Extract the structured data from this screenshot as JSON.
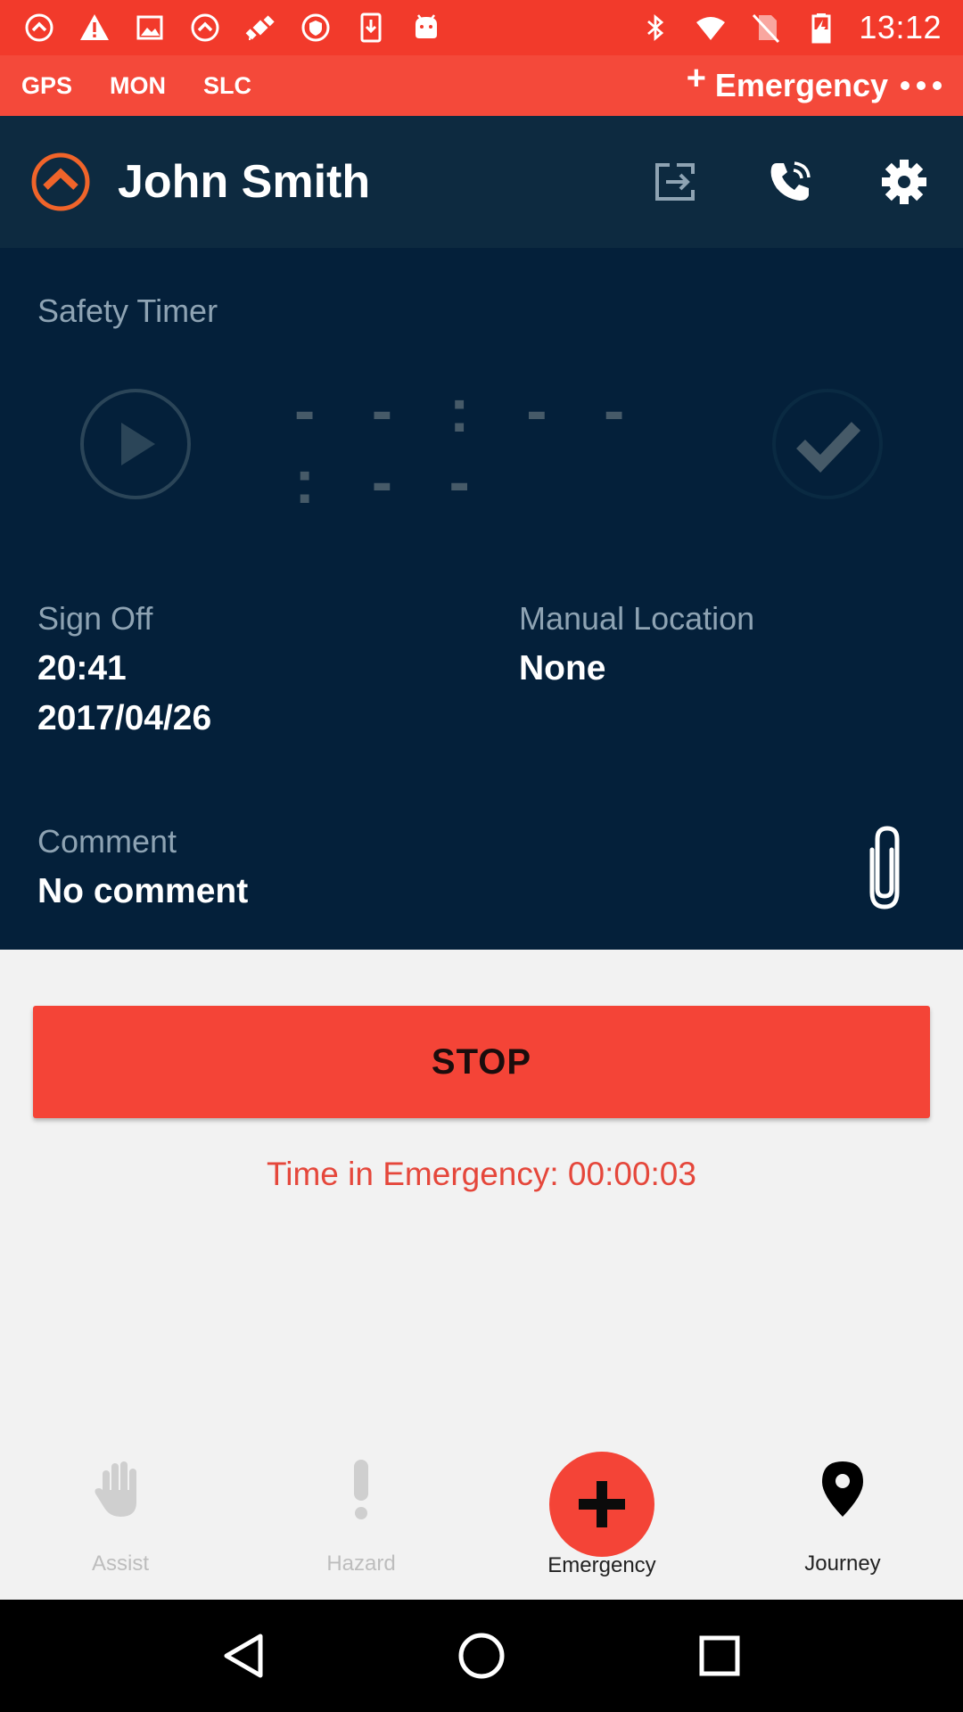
{
  "status_bar": {
    "time": "13:12",
    "left_icons": [
      "app-chevron-icon",
      "warning-icon",
      "image-icon",
      "app-chevron-icon",
      "fake-gps-icon",
      "shield-icon",
      "download-icon",
      "android-icon"
    ],
    "right_icons": [
      "bluetooth-icon",
      "wifi-icon",
      "no-sim-icon",
      "battery-charging-icon"
    ]
  },
  "mode_bar": {
    "tags": [
      "GPS",
      "MON",
      "SLC"
    ],
    "emergency_label": "Emergency",
    "plus": "+"
  },
  "header": {
    "user_name": "John Smith"
  },
  "safety_timer": {
    "label": "Safety Timer",
    "display": "- - : - - : - -"
  },
  "sign_off": {
    "label": "Sign Off",
    "time": "20:41",
    "date": "2017/04/26"
  },
  "manual_location": {
    "label": "Manual Location",
    "value": "None"
  },
  "comment": {
    "label": "Comment",
    "value": "No comment"
  },
  "actions": {
    "stop_label": "STOP",
    "emergency_time": "Time in Emergency: 00:00:03"
  },
  "bottom_nav": {
    "items": [
      {
        "label": "Assist"
      },
      {
        "label": "Hazard"
      },
      {
        "label": "Emergency"
      },
      {
        "label": "Journey"
      }
    ]
  },
  "colors": {
    "status_bar": "#f23a2b",
    "mode_bar": "#f4493a",
    "header": "#0d2a40",
    "panel": "#04203a",
    "accent": "#f44437",
    "logo_orange": "#f0642a"
  }
}
